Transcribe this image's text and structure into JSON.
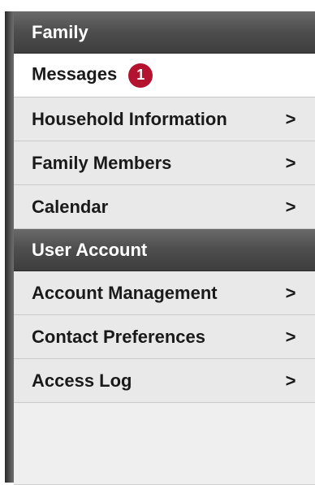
{
  "sections": {
    "family": {
      "title": "Family",
      "items": [
        {
          "label": "Messages",
          "badge": "1",
          "has_chevron": false,
          "active": true
        },
        {
          "label": "Household Information",
          "chevron": ">"
        },
        {
          "label": "Family Members",
          "chevron": ">"
        },
        {
          "label": "Calendar",
          "chevron": ">"
        }
      ]
    },
    "user_account": {
      "title": "User Account",
      "items": [
        {
          "label": "Account Management",
          "chevron": ">"
        },
        {
          "label": "Contact Preferences",
          "chevron": ">"
        },
        {
          "label": "Access Log",
          "chevron": ">"
        }
      ]
    }
  },
  "colors": {
    "header_bg": "#4f4f4f",
    "badge_bg": "#b3132f",
    "item_bg": "#e9e9e9",
    "active_item_bg": "#ffffff"
  },
  "icons": {
    "chevron": "chevron-right-icon",
    "badge": "notification-badge"
  }
}
